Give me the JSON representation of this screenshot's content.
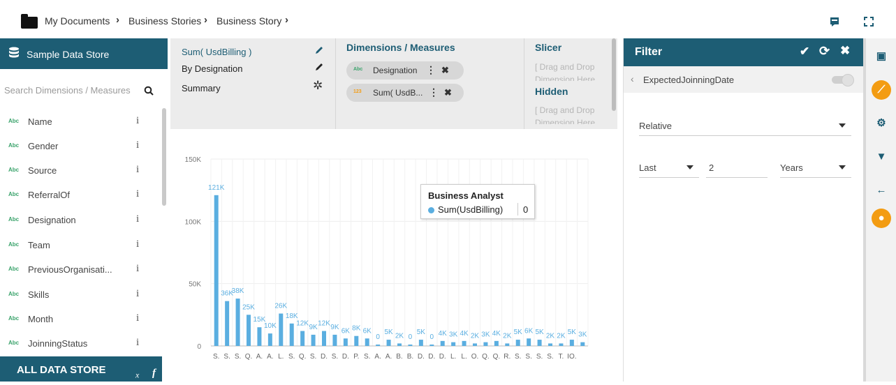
{
  "breadcrumb": {
    "items": [
      "My Documents",
      "Business Stories",
      "Business Story"
    ]
  },
  "left_panel": {
    "title": "Sample Data Store",
    "search_placeholder": "Search Dimensions / Measures",
    "type_badge": "Abc",
    "info_glyph": "i",
    "fields": [
      "Name",
      "Gender",
      "Source",
      "ReferralOf",
      "Designation",
      "Team",
      "PreviousOrganisati...",
      "Skills",
      "Month",
      "JoinningStatus"
    ],
    "footer_label": "ALL DATA STORE",
    "footer_fx": "f",
    "footer_fx_sub": "x"
  },
  "builder": {
    "items": [
      {
        "label": "Sum( UsdBilling )",
        "icon": "pencil-icon"
      },
      {
        "label": "By Designation",
        "icon": "pencil-icon"
      },
      {
        "label": "Summary",
        "icon": "gear-icon"
      }
    ],
    "dims_title": "Dimensions / Measures",
    "pills": [
      {
        "badge": "Abc",
        "label": "Designation"
      },
      {
        "badge": "123",
        "label": "Sum( UsdB..."
      }
    ],
    "slicer_title": "Slicer",
    "slicer_drag": [
      "[ Drag and Drop",
      "Dimension Here"
    ],
    "hidden_title": "Hidden",
    "hidden_drag": [
      "[ Drag and Drop",
      "Dimension Here"
    ]
  },
  "tooltip": {
    "title": "Business Analyst",
    "series": "Sum(UsdBilling)",
    "value": "0"
  },
  "filter_panel": {
    "title": "Filter",
    "field": "ExpectedJoinningDate",
    "mode": "Relative",
    "period_dir": "Last",
    "period_count": "2",
    "period_unit": "Years"
  },
  "colors": {
    "brand": "#1d5d74",
    "bar": "#5aaee0",
    "accent": "#f39c12"
  },
  "chart_data": {
    "type": "bar",
    "categories": [
      "S.",
      "S.",
      "S.",
      "Q.",
      "A.",
      "A.",
      "L.",
      "S.",
      "Q.",
      "S.",
      "D.",
      "S.",
      "D.",
      "P.",
      "S.",
      "A.",
      "A.",
      "B.",
      "B.",
      "D.",
      "D.",
      "D.",
      "L.",
      "L.",
      "O.",
      "Q.",
      "Q.",
      "R.",
      "S.",
      "S.",
      "S.",
      "S.",
      "T.",
      "IO."
    ],
    "values": [
      121,
      36,
      38,
      25,
      15,
      10,
      26,
      18,
      12,
      9,
      12,
      9,
      6,
      8,
      6,
      0,
      5,
      2,
      0,
      5,
      0,
      4,
      3,
      4,
      2,
      3,
      4,
      2,
      5,
      6,
      5,
      2,
      2,
      5,
      3
    ],
    "data_labels": [
      "121K",
      "36K",
      "38K",
      "25K",
      "15K",
      "10K",
      "26K",
      "18K",
      "12K",
      "9K",
      "12K",
      "9K",
      "6K",
      "8K",
      "6K",
      "0",
      "5K",
      "2K",
      "0",
      "5K",
      "0",
      "4K",
      "3K",
      "4K",
      "2K",
      "3K",
      "4K",
      "2K",
      "5K",
      "6K",
      "5K",
      "2K",
      "2K",
      "5K",
      "3K"
    ],
    "y_ticks": [
      "0",
      "50K",
      "100K",
      "150K"
    ],
    "ylim": [
      0,
      150
    ],
    "grid": true
  }
}
